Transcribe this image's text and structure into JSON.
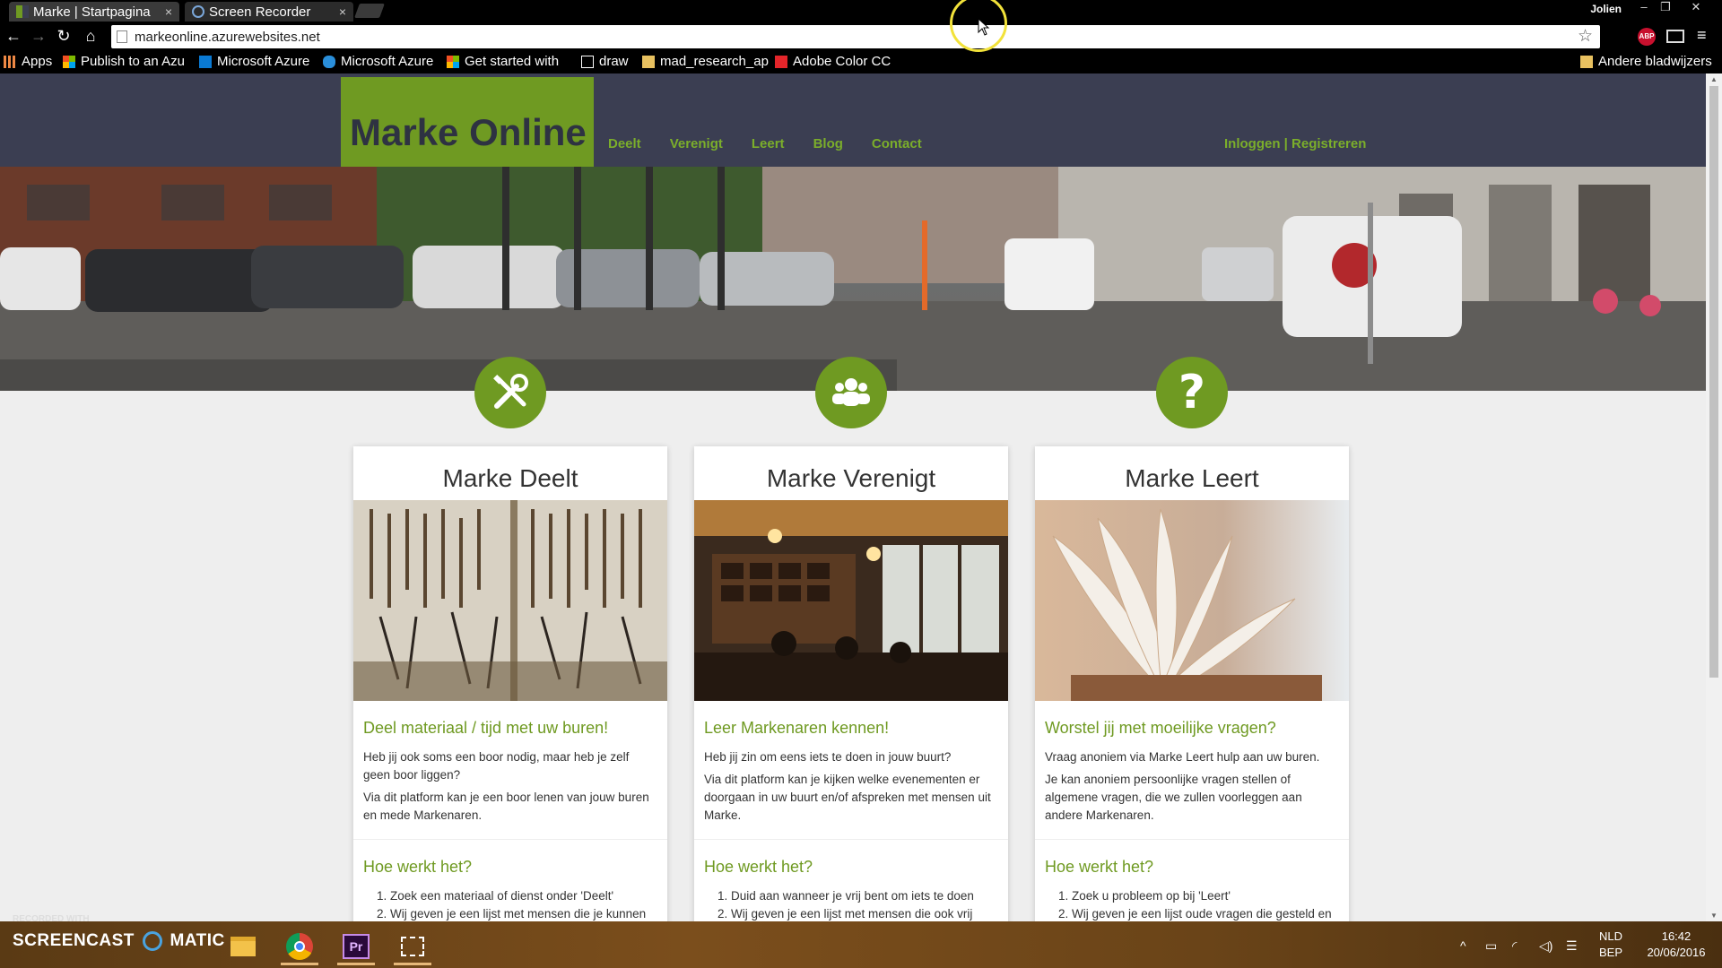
{
  "browser": {
    "tabs": [
      {
        "label": "Marke | Startpagina",
        "active": true
      },
      {
        "label": "Screen Recorder",
        "active": false
      }
    ],
    "user": "Jolien",
    "url": "markeonline.azurewebsites.net",
    "bookmarks": [
      "Apps",
      "Publish to an Azu",
      "Microsoft Azure",
      "Microsoft Azure",
      "Get started with",
      "draw",
      "mad_research_ap",
      "Adobe Color CC"
    ],
    "other_bookmarks": "Andere bladwijzers",
    "extensions": {
      "abp": "ABP"
    }
  },
  "site": {
    "brand": "Marke Online",
    "nav": [
      "Deelt",
      "Verenigt",
      "Leert",
      "Blog",
      "Contact"
    ],
    "auth": "Inloggen | Registreren",
    "cards": [
      {
        "title": "Marke Deelt",
        "heading": "Deel materiaal / tijd met uw buren!",
        "paragraphs": [
          "Heb jij ook soms een boor nodig, maar heb je zelf geen boor liggen?",
          "Via dit platform kan je een boor lenen van jouw buren en mede Markenaren."
        ],
        "how_title": "Hoe werkt het?",
        "steps": [
          "Zoek een materiaal of dienst onder 'Deelt'",
          "Wij geven je een lijst met mensen die je kunnen"
        ]
      },
      {
        "title": "Marke Verenigt",
        "heading": "Leer Markenaren kennen!",
        "paragraphs": [
          "Heb jij zin om eens iets te doen in jouw buurt?",
          "Via dit platform kan je kijken welke evenementen er doorgaan in uw buurt en/of afspreken met mensen uit Marke."
        ],
        "how_title": "Hoe werkt het?",
        "steps": [
          "Duid aan wanneer je vrij bent om iets te doen",
          "Wij geven je een lijst met mensen die ook vrij"
        ]
      },
      {
        "title": "Marke Leert",
        "heading": "Worstel jij met moeilijke vragen?",
        "paragraphs": [
          "Vraag anoniem via Marke Leert hulp aan uw buren.",
          "Je kan anoniem persoonlijke vragen stellen of algemene vragen, die we zullen voorleggen aan andere Markenaren."
        ],
        "how_title": "Hoe werkt het?",
        "steps": [
          "Zoek u probleem op bij 'Leert'",
          "Wij geven je een lijst oude vragen die gesteld en"
        ]
      }
    ],
    "accent_color": "#6f9a22",
    "header_color": "#3b3e52"
  },
  "taskbar": {
    "recorded_label": "RECORDED WITH",
    "screencast_logo": "SCREENCAST",
    "screencast_logo_suffix": "MATIC",
    "language": "NLD",
    "layout": "BEP",
    "time": "16:42",
    "date": "20/06/2016"
  }
}
